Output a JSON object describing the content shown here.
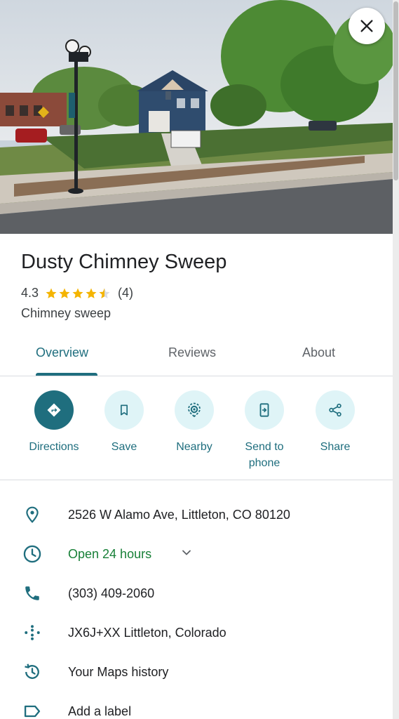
{
  "place": {
    "name": "Dusty Chimney Sweep",
    "rating": "4.3",
    "rating_value": 4.3,
    "review_count": "(4)",
    "category": "Chimney sweep"
  },
  "tabs": [
    {
      "label": "Overview",
      "active": true
    },
    {
      "label": "Reviews",
      "active": false
    },
    {
      "label": "About",
      "active": false
    }
  ],
  "actions": [
    {
      "label": "Directions",
      "icon": "directions-icon"
    },
    {
      "label": "Save",
      "icon": "bookmark-icon"
    },
    {
      "label": "Nearby",
      "icon": "nearby-icon"
    },
    {
      "label": "Send to phone",
      "icon": "send-to-phone-icon"
    },
    {
      "label": "Share",
      "icon": "share-icon"
    }
  ],
  "info": {
    "address": "2526 W Alamo Ave, Littleton, CO 80120",
    "hours": "Open 24 hours",
    "phone": "(303) 409-2060",
    "plus_code": "JX6J+XX Littleton, Colorado",
    "history": "Your Maps history",
    "add_label": "Add a label"
  },
  "colors": {
    "accent": "#1f6e7e",
    "action_bg": "#dff4f7",
    "open_green": "#188038",
    "star": "#f4b400"
  }
}
